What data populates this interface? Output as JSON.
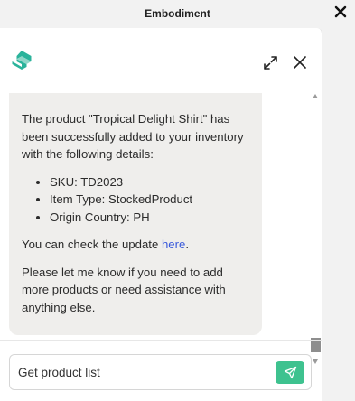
{
  "window": {
    "title": "Embodiment",
    "close_icon": "close-icon"
  },
  "header": {
    "logo_icon": "brand-logo-icon",
    "brand_color": "#2bb39b",
    "expand_icon": "expand-icon",
    "close_icon": "close-icon"
  },
  "message": {
    "intro": "The product \"Tropical Delight Shirt\" has been successfully added to your inventory with the following details:",
    "details": [
      "SKU: TD2023",
      "Item Type: StockedProduct",
      "Origin Country: PH"
    ],
    "check_prefix": "You can check the update ",
    "check_link": "here",
    "check_suffix": ".",
    "closing": "Please let me know if you need to add more products or need assistance with anything else."
  },
  "composer": {
    "input_value": "Get product list",
    "send_icon": "send-icon",
    "send_color": "#3ec28f"
  }
}
